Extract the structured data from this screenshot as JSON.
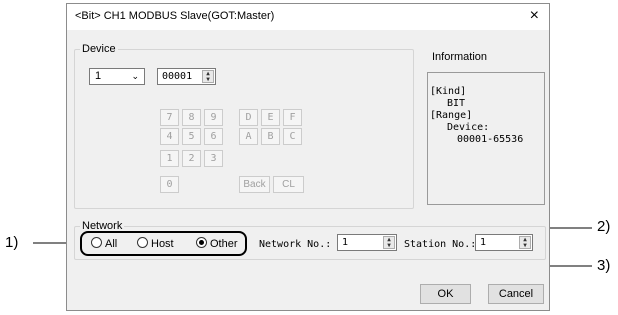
{
  "window": {
    "title": "<Bit> CH1 MODBUS Slave(GOT:Master)",
    "close_glyph": "×"
  },
  "device": {
    "group_label": "Device",
    "station_select": "1",
    "address": "00001",
    "keypad": {
      "row1": [
        "7",
        "8",
        "9",
        "D",
        "E",
        "F"
      ],
      "row2": [
        "4",
        "5",
        "6",
        "A",
        "B",
        "C"
      ],
      "row3": [
        "1",
        "2",
        "3"
      ],
      "row4": [
        "0",
        "Back",
        "CL"
      ]
    }
  },
  "information": {
    "title": "Information",
    "kind_label": "[Kind]",
    "kind_value": "BIT",
    "range_label": "[Range]",
    "range_device": "Device:",
    "range_value": "00001-65536"
  },
  "network": {
    "group_label": "Network",
    "options": [
      "All",
      "Host",
      "Other"
    ],
    "selected": "Other",
    "network_no_label": "Network No.:",
    "network_no": "1",
    "station_no_label": "Station No.:",
    "station_no": "1"
  },
  "buttons": {
    "ok": "OK",
    "cancel": "Cancel"
  },
  "callouts": {
    "c1": "1)",
    "c2": "2)",
    "c3": "3)"
  }
}
